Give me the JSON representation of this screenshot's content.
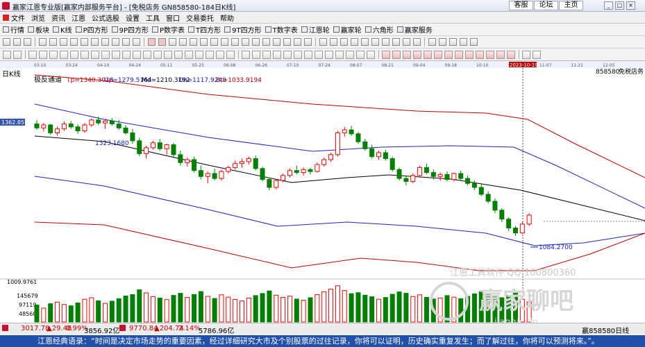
{
  "window": {
    "title": "赢家江恩专业版[赢家内部服务平台] - [免税店务   GN858580-184日K线]",
    "links": [
      "客服",
      "论坛",
      "主页"
    ],
    "controls": [
      "_",
      "□",
      "×"
    ]
  },
  "menu": [
    "文件",
    "浏览",
    "资讯",
    "江恩",
    "公式选股",
    "设置",
    "工具",
    "窗口",
    "交易委托",
    "帮助"
  ],
  "toolbar1": [
    "行情",
    "板块",
    "K线",
    "P四方形",
    "9P四方形",
    "P数字表",
    "T四方形",
    "9T四方形",
    "T数字表",
    "江恩轮",
    "赢家轮",
    "六角形",
    "赢家服务"
  ],
  "chart": {
    "period_label": "日K线",
    "indicator_name": "极反通道",
    "indicator_values": {
      "tp": "Tp=1340.3018",
      "up": "Up=1279.5164",
      "md": "Md=1210.3192",
      "dn": "Dn=1117.9248",
      "bt": "Bt=1033.9194"
    },
    "code_label": "858580",
    "name_label": "免税店务",
    "date_ticks": [
      "03-10",
      "03-24",
      "04-10",
      "04-24",
      "05-11",
      "05-25",
      "06-08",
      "06-26",
      "07-10",
      "07-24",
      "08-07",
      "08-21",
      "09-04",
      "09-18",
      "10-10",
      "2023-10-19",
      "11-07",
      "11-21",
      "12-05"
    ],
    "highlight_date": "2023-10-19",
    "price_left_label": "1362.8579",
    "high_annotation": "1323.1680",
    "low_annotation": "1084.2700",
    "volume_axis": [
      "1009.9761",
      "145679",
      "97119",
      "48560"
    ],
    "watermark_top": "江恩工具软件 QQ:100800360",
    "watermark_logo": "赢家聊吧",
    "watermark_sub": "jiaoba.vip"
  },
  "chart_data": {
    "type": "candlestick",
    "ylim": [
      1000,
      1420
    ],
    "colors": {
      "up": "#ff0000",
      "down": "#008000",
      "top_band": "#c00000",
      "mid_band": "#2020c0",
      "center": "#000000"
    },
    "candles": [
      [
        1310,
        1318,
        1298,
        1302
      ],
      [
        1302,
        1312,
        1295,
        1308
      ],
      [
        1308,
        1310,
        1288,
        1292
      ],
      [
        1292,
        1305,
        1286,
        1300
      ],
      [
        1300,
        1315,
        1296,
        1310
      ],
      [
        1310,
        1316,
        1300,
        1304
      ],
      [
        1304,
        1309,
        1290,
        1296
      ],
      [
        1296,
        1312,
        1292,
        1308
      ],
      [
        1308,
        1321,
        1304,
        1318
      ],
      [
        1318,
        1325,
        1308,
        1312
      ],
      [
        1312,
        1320,
        1300,
        1316
      ],
      [
        1316,
        1322,
        1306,
        1310
      ],
      [
        1310,
        1318,
        1298,
        1302
      ],
      [
        1302,
        1308,
        1288,
        1292
      ],
      [
        1292,
        1300,
        1270,
        1276
      ],
      [
        1276,
        1282,
        1245,
        1250
      ],
      [
        1250,
        1266,
        1240,
        1262
      ],
      [
        1262,
        1276,
        1258,
        1272
      ],
      [
        1272,
        1280,
        1256,
        1260
      ],
      [
        1260,
        1270,
        1248,
        1268
      ],
      [
        1268,
        1272,
        1244,
        1248
      ],
      [
        1248,
        1256,
        1226,
        1232
      ],
      [
        1232,
        1242,
        1224,
        1238
      ],
      [
        1238,
        1244,
        1212,
        1216
      ],
      [
        1216,
        1226,
        1198,
        1204
      ],
      [
        1204,
        1214,
        1190,
        1210
      ],
      [
        1210,
        1220,
        1196,
        1200
      ],
      [
        1200,
        1218,
        1196,
        1214
      ],
      [
        1214,
        1226,
        1210,
        1222
      ],
      [
        1222,
        1236,
        1218,
        1230
      ],
      [
        1230,
        1240,
        1222,
        1234
      ],
      [
        1234,
        1244,
        1228,
        1240
      ],
      [
        1240,
        1246,
        1216,
        1220
      ],
      [
        1220,
        1224,
        1194,
        1198
      ],
      [
        1198,
        1200,
        1176,
        1182
      ],
      [
        1182,
        1198,
        1178,
        1196
      ],
      [
        1196,
        1210,
        1192,
        1206
      ],
      [
        1206,
        1220,
        1202,
        1216
      ],
      [
        1216,
        1226,
        1208,
        1212
      ],
      [
        1212,
        1222,
        1206,
        1218
      ],
      [
        1218,
        1222,
        1208,
        1214
      ],
      [
        1214,
        1232,
        1212,
        1228
      ],
      [
        1228,
        1242,
        1224,
        1238
      ],
      [
        1238,
        1252,
        1234,
        1248
      ],
      [
        1248,
        1296,
        1244,
        1292
      ],
      [
        1292,
        1304,
        1284,
        1298
      ],
      [
        1298,
        1306,
        1286,
        1290
      ],
      [
        1290,
        1294,
        1270,
        1274
      ],
      [
        1274,
        1280,
        1256,
        1260
      ],
      [
        1260,
        1268,
        1240,
        1244
      ],
      [
        1244,
        1256,
        1238,
        1252
      ],
      [
        1252,
        1258,
        1236,
        1240
      ],
      [
        1240,
        1244,
        1214,
        1218
      ],
      [
        1218,
        1222,
        1196,
        1200
      ],
      [
        1200,
        1206,
        1186,
        1194
      ],
      [
        1194,
        1210,
        1190,
        1206
      ],
      [
        1206,
        1226,
        1202,
        1222
      ],
      [
        1222,
        1230,
        1208,
        1212
      ],
      [
        1212,
        1218,
        1198,
        1204
      ],
      [
        1204,
        1212,
        1196,
        1208
      ],
      [
        1208,
        1214,
        1194,
        1198
      ],
      [
        1198,
        1212,
        1194,
        1210
      ],
      [
        1210,
        1216,
        1196,
        1200
      ],
      [
        1200,
        1206,
        1186,
        1190
      ],
      [
        1190,
        1196,
        1176,
        1182
      ],
      [
        1182,
        1188,
        1164,
        1168
      ],
      [
        1168,
        1174,
        1150,
        1154
      ],
      [
        1154,
        1160,
        1130,
        1136
      ],
      [
        1136,
        1140,
        1112,
        1118
      ],
      [
        1118,
        1122,
        1094,
        1100
      ],
      [
        1100,
        1104,
        1084,
        1090
      ],
      [
        1090,
        1112,
        1088,
        1108
      ],
      [
        1108,
        1130,
        1104,
        1126
      ]
    ],
    "volume_max": 194238,
    "volume": [
      88000,
      72000,
      95000,
      103000,
      91000,
      84000,
      99000,
      118000,
      126000,
      110000,
      97000,
      108000,
      121000,
      135000,
      142000,
      167000,
      151000,
      132000,
      124000,
      116000,
      138000,
      149000,
      128000,
      143000,
      158000,
      133000,
      122000,
      141000,
      129000,
      117000,
      109000,
      124000,
      137000,
      148000,
      161000,
      139000,
      128000,
      134000,
      119000,
      113000,
      126000,
      142000,
      157000,
      171000,
      188000,
      163000,
      147000,
      152000,
      139000,
      131000,
      118000,
      127000,
      144000,
      156000,
      149000,
      132000,
      141000,
      128000,
      119000,
      124000,
      137000,
      129000,
      121000,
      133000,
      146000,
      158000,
      142000,
      131000,
      126000,
      139000,
      152000,
      118000,
      104000
    ]
  },
  "status": {
    "sh_index": "3017.78",
    "sh_change": "▲29.48",
    "sh_pct": "0.99%",
    "sh_amount": "3856.92亿",
    "sz_index": "9770.84",
    "sz_change": "▲204.74",
    "sz_pct": "2.14%",
    "sz_amount": "5786.96亿",
    "right_label": "赢858580日线"
  },
  "ticker": "江恩经典语录：“时间是决定市场走势的重要因素，经过详细研究大市及个别股票的过往记录，你将可以证明，历史确实重复发生；而了解过往，你将可以预测将来。”。"
}
